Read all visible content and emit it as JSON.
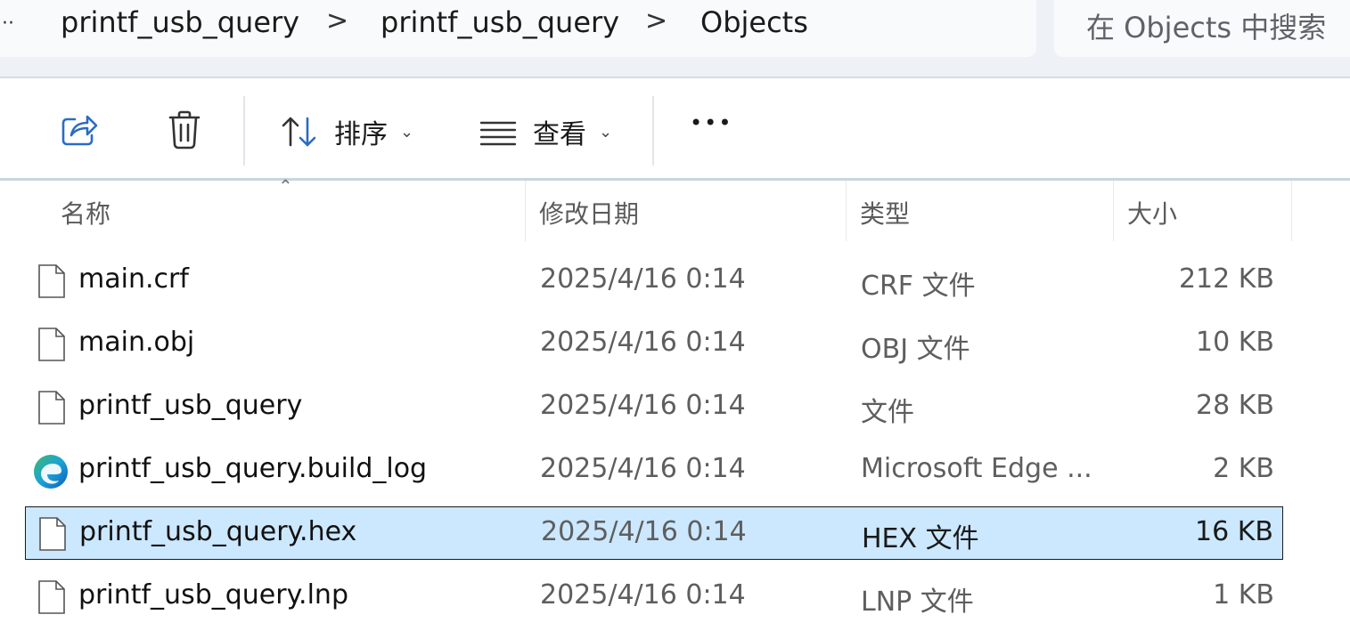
{
  "breadcrumb": {
    "overflow": "··",
    "items": [
      "printf_usb_query",
      "printf_usb_query",
      "Objects"
    ],
    "separator": ">"
  },
  "search": {
    "placeholder": "在 Objects 中搜索"
  },
  "toolbar": {
    "share_icon": "share-icon",
    "delete_icon": "trash-icon",
    "sort_label": "排序",
    "view_label": "查看",
    "more_label": "•••"
  },
  "columns": {
    "name": "名称",
    "date": "修改日期",
    "type": "类型",
    "size": "大小"
  },
  "files": [
    {
      "name": "main.crf",
      "date": "2025/4/16 0:14",
      "type": "CRF 文件",
      "size": "212 KB",
      "icon": "file-icon",
      "selected": false
    },
    {
      "name": "main.obj",
      "date": "2025/4/16 0:14",
      "type": "OBJ 文件",
      "size": "10 KB",
      "icon": "file-icon",
      "selected": false
    },
    {
      "name": "printf_usb_query",
      "date": "2025/4/16 0:14",
      "type": "文件",
      "size": "28 KB",
      "icon": "file-icon",
      "selected": false
    },
    {
      "name": "printf_usb_query.build_log",
      "date": "2025/4/16 0:14",
      "type": "Microsoft Edge ...",
      "size": "2 KB",
      "icon": "edge-icon",
      "selected": false
    },
    {
      "name": "printf_usb_query.hex",
      "date": "2025/4/16 0:14",
      "type": "HEX 文件",
      "size": "16 KB",
      "icon": "file-icon",
      "selected": true
    },
    {
      "name": "printf_usb_query.lnp",
      "date": "2025/4/16 0:14",
      "type": "LNP 文件",
      "size": "1 KB",
      "icon": "file-icon",
      "selected": false
    }
  ],
  "colors": {
    "selected_bg": "#cce8ff",
    "edge_blue": "#0f7fd6",
    "edge_green": "#3fb96a"
  }
}
